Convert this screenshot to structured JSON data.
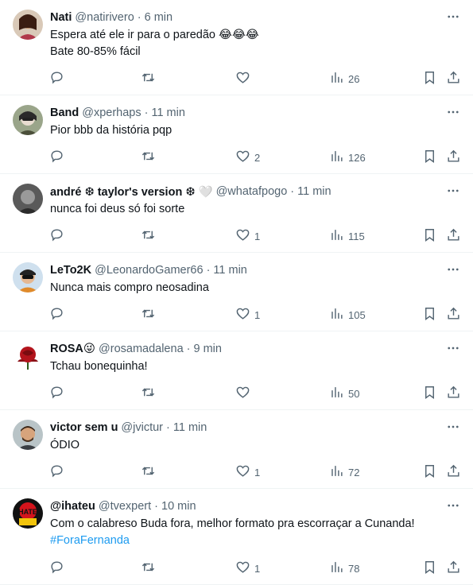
{
  "tweets": [
    {
      "name": "Nati",
      "handle": "@natirivero",
      "time": "6 min",
      "text": [
        "Espera até ele ir para o paredão 😂😂😂",
        "Bate 80-85% fácil"
      ],
      "likes": "",
      "views": "26",
      "retweets": ""
    },
    {
      "name": "Band",
      "handle": "@xperhaps",
      "time": "11 min",
      "text": [
        "Pior bbb da história pqp"
      ],
      "likes": "2",
      "views": "126",
      "retweets": ""
    },
    {
      "name": "andré ❆ taylor's version ❆ 🤍",
      "handle": "@whatafpogo",
      "time": "11 min",
      "text": [
        "nunca foi deus só foi sorte"
      ],
      "likes": "1",
      "views": "115",
      "retweets": ""
    },
    {
      "name": "LeTo2K",
      "handle": "@LeonardoGamer66",
      "time": "11 min",
      "text": [
        "Nunca mais compro neosadina"
      ],
      "likes": "1",
      "views": "105",
      "retweets": ""
    },
    {
      "name": "ROSA😜",
      "handle": "@rosamadalena",
      "time": "9 min",
      "text": [
        "Tchau bonequinha!"
      ],
      "likes": "",
      "views": "50",
      "retweets": ""
    },
    {
      "name": "victor sem u",
      "handle": "@jvictur",
      "time": "11 min",
      "text": [
        "ÓDIO"
      ],
      "likes": "1",
      "views": "72",
      "retweets": ""
    },
    {
      "name": "@ihateu",
      "handle": "@tvexpert",
      "time": "10 min",
      "text": [
        "Com o calabreso Buda fora, melhor formato pra escorraçar a Cunanda!"
      ],
      "hashtag": "#ForaFernanda",
      "likes": "1",
      "views": "78",
      "retweets": ""
    }
  ],
  "icons": {
    "more": "more-horizontal-icon",
    "reply": "reply-icon",
    "retweet": "retweet-icon",
    "like": "heart-icon",
    "views": "views-chart-icon",
    "bookmark": "bookmark-icon",
    "share": "share-icon"
  },
  "colors": {
    "accent": "#1d9bf0",
    "muted": "#536471",
    "text": "#0f1419",
    "divider": "#eff3f4"
  }
}
